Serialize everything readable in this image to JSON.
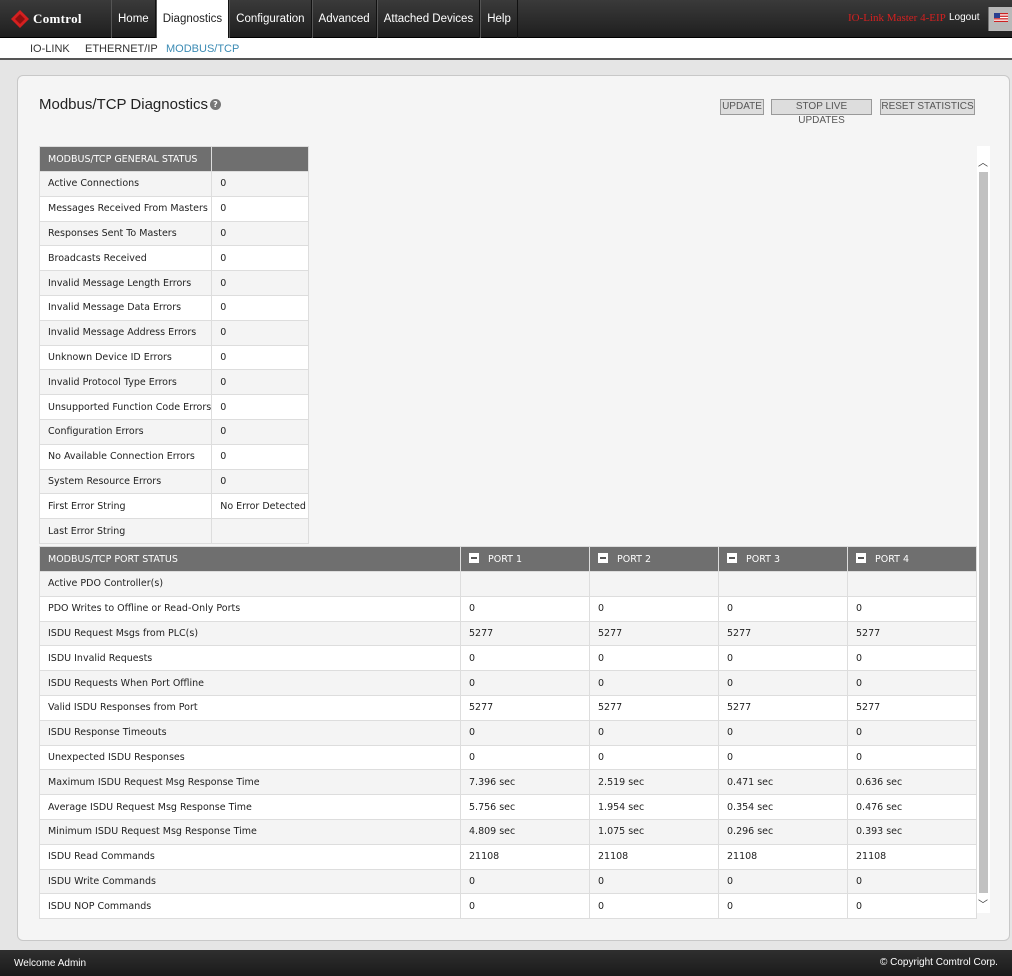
{
  "logo": {
    "text": "Comtrol"
  },
  "nav": {
    "items": [
      "Home",
      "Diagnostics",
      "Configuration",
      "Advanced",
      "Attached Devices",
      "Help"
    ],
    "active": "Diagnostics"
  },
  "header": {
    "device_name": "IO-Link Master 4-EIP",
    "logout": "Logout",
    "flag": "us-flag-icon"
  },
  "subnav": {
    "items": [
      "IO-LINK",
      "ETHERNET/IP",
      "MODBUS/TCP"
    ],
    "active": "MODBUS/TCP"
  },
  "page": {
    "title": "Modbus/TCP Diagnostics",
    "help": "?"
  },
  "toolbar": {
    "update": "UPDATE",
    "stop": "STOP LIVE UPDATES",
    "reset": "RESET STATISTICS"
  },
  "general_status": {
    "header": "MODBUS/TCP GENERAL STATUS",
    "rows": [
      {
        "label": "Active Connections",
        "value": "0"
      },
      {
        "label": "Messages Received From Masters",
        "value": "0"
      },
      {
        "label": "Responses Sent To Masters",
        "value": "0"
      },
      {
        "label": "Broadcasts Received",
        "value": "0"
      },
      {
        "label": "Invalid Message Length Errors",
        "value": "0"
      },
      {
        "label": "Invalid Message Data Errors",
        "value": "0"
      },
      {
        "label": "Invalid Message Address Errors",
        "value": "0"
      },
      {
        "label": "Unknown Device ID Errors",
        "value": "0"
      },
      {
        "label": "Invalid Protocol Type Errors",
        "value": "0"
      },
      {
        "label": "Unsupported Function Code Errors",
        "value": "0"
      },
      {
        "label": "Configuration Errors",
        "value": "0"
      },
      {
        "label": "No Available Connection Errors",
        "value": "0"
      },
      {
        "label": "System Resource Errors",
        "value": "0"
      },
      {
        "label": "First Error String",
        "value": "No Error Detected"
      },
      {
        "label": "Last Error String",
        "value": ""
      }
    ]
  },
  "port_status": {
    "header": "MODBUS/TCP PORT STATUS",
    "ports": [
      "PORT 1",
      "PORT 2",
      "PORT 3",
      "PORT 4"
    ],
    "rows": [
      {
        "label": "Active PDO Controller(s)",
        "values": [
          "",
          "",
          "",
          ""
        ]
      },
      {
        "label": "PDO Writes to Offline or Read-Only Ports",
        "values": [
          "0",
          "0",
          "0",
          "0"
        ]
      },
      {
        "label": "ISDU Request Msgs from PLC(s)",
        "values": [
          "5277",
          "5277",
          "5277",
          "5277"
        ]
      },
      {
        "label": "ISDU Invalid Requests",
        "values": [
          "0",
          "0",
          "0",
          "0"
        ]
      },
      {
        "label": "ISDU Requests When Port Offline",
        "values": [
          "0",
          "0",
          "0",
          "0"
        ]
      },
      {
        "label": "Valid ISDU Responses from Port",
        "values": [
          "5277",
          "5277",
          "5277",
          "5277"
        ]
      },
      {
        "label": "ISDU Response Timeouts",
        "values": [
          "0",
          "0",
          "0",
          "0"
        ]
      },
      {
        "label": "Unexpected ISDU Responses",
        "values": [
          "0",
          "0",
          "0",
          "0"
        ]
      },
      {
        "label": "Maximum ISDU Request Msg Response Time",
        "values": [
          "7.396 sec",
          "2.519 sec",
          "0.471 sec",
          "0.636 sec"
        ]
      },
      {
        "label": "Average ISDU Request Msg Response Time",
        "values": [
          "5.756 sec",
          "1.954 sec",
          "0.354 sec",
          "0.476 sec"
        ]
      },
      {
        "label": "Minimum ISDU Request Msg Response Time",
        "values": [
          "4.809 sec",
          "1.075 sec",
          "0.296 sec",
          "0.393 sec"
        ]
      },
      {
        "label": "ISDU Read Commands",
        "values": [
          "21108",
          "21108",
          "21108",
          "21108"
        ]
      },
      {
        "label": "ISDU Write Commands",
        "values": [
          "0",
          "0",
          "0",
          "0"
        ]
      },
      {
        "label": "ISDU NOP Commands",
        "values": [
          "0",
          "0",
          "0",
          "0"
        ]
      }
    ]
  },
  "footer": {
    "welcome": "Welcome Admin",
    "copyright": "© Copyright Comtrol Corp."
  }
}
